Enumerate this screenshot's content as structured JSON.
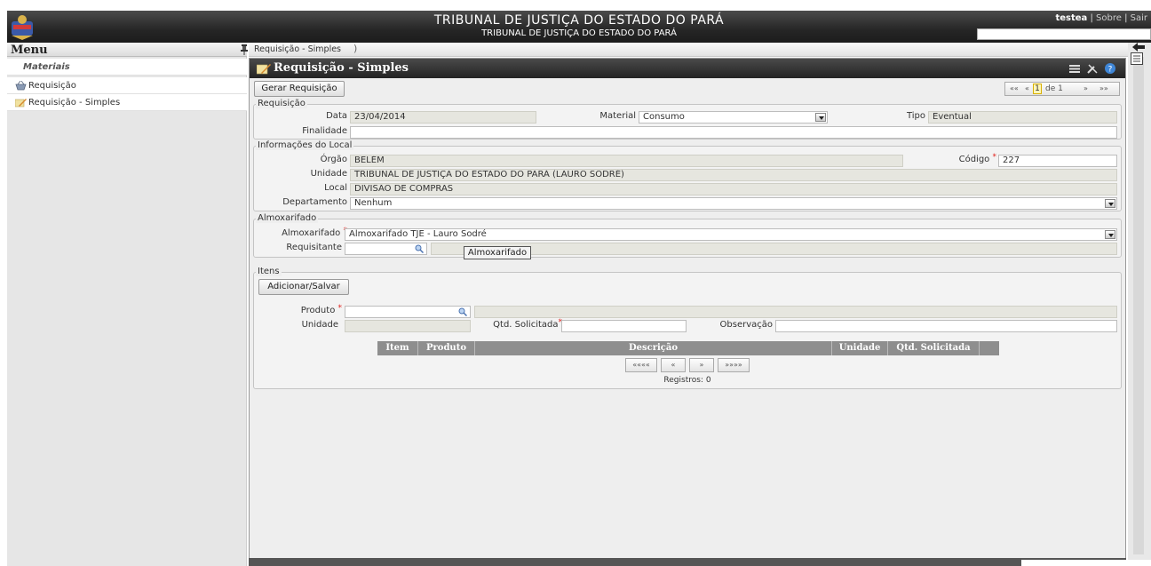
{
  "header": {
    "title": "TRIBUNAL DE JUSTIÇA DO ESTADO DO PARÁ",
    "subtitle": "TRIBUNAL DE JUSTIÇA DO ESTADO DO PARÁ",
    "user": "testea",
    "sep1": "|",
    "sobre": "Sobre",
    "sep2": "|",
    "sair": "Sair"
  },
  "menu": {
    "title": "Menu",
    "section": "Materiais",
    "items": [
      {
        "label": "Requisição",
        "icon": "basket-icon"
      },
      {
        "label": "Requisição - Simples",
        "icon": "pencil-icon"
      }
    ]
  },
  "breadcrumb": "Requisição - Simples",
  "panel": {
    "title": "Requisição - Simples",
    "gerar_button": "Gerar Requisição",
    "pager": {
      "first": "««",
      "prev": "«",
      "page": "1",
      "of": "de 1",
      "next": "»",
      "last": "»»"
    }
  },
  "requisicao": {
    "legend": "Requisição",
    "data_label": "Data",
    "data_value": "23/04/2014",
    "material_label": "Material",
    "material_value": "Consumo",
    "tipo_label": "Tipo",
    "tipo_value": "Eventual",
    "finalidade_label": "Finalidade",
    "finalidade_value": ""
  },
  "local": {
    "legend": "Informações do Local",
    "orgao_label": "Órgão",
    "orgao_value": "BELÉM",
    "codigo_label": "Código",
    "codigo_value": "227",
    "unidade_label": "Unidade",
    "unidade_value": "TRIBUNAL DE JUSTIÇA DO ESTADO DO PARÁ (LAURO SODRÉ)",
    "local_label": "Local",
    "local_value": "DIVISÃO DE COMPRAS",
    "departamento_label": "Departamento",
    "departamento_value": "Nenhum"
  },
  "almox": {
    "legend": "Almoxarifado",
    "almox_label": "Almoxarifado",
    "almox_value": "Almoxarifado TJE - Lauro Sodré",
    "requisitante_label": "Requisitante",
    "requisitante_value": "",
    "tooltip": "Almoxarifado"
  },
  "itens": {
    "legend": "Itens",
    "add_button": "Adicionar/Salvar",
    "produto_label": "Produto",
    "unidade_label": "Unidade",
    "qtd_label": "Qtd. Solicitada",
    "obs_label": "Observação",
    "columns": [
      "Item",
      "Produto",
      "Descrição",
      "Unidade",
      "Qtd. Solicitada"
    ],
    "pager": {
      "first": "««««",
      "prev": "«",
      "next": "»",
      "last": "»»»»"
    },
    "registros": "Registros: 0"
  },
  "colors": {
    "header_bg": "#262626",
    "required": "#e0201b",
    "table_header": "#8e8e8e"
  }
}
